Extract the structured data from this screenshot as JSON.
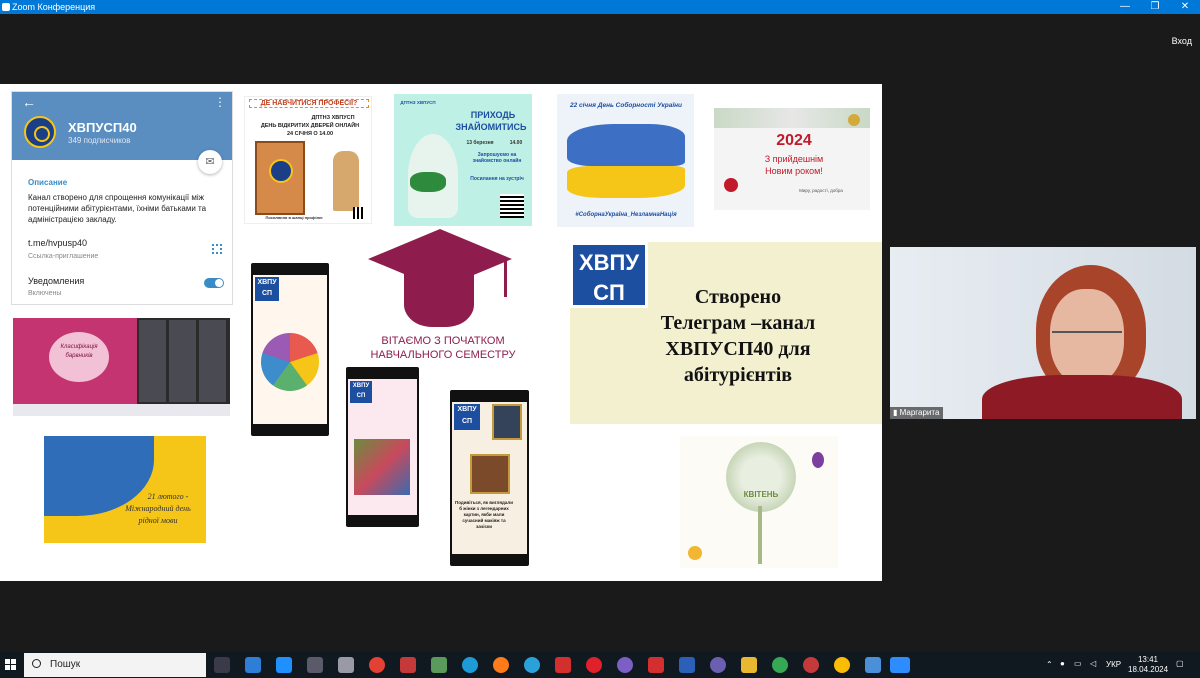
{
  "window": {
    "title": "Zoom Конференция",
    "minimize": "—",
    "maximize": "❐",
    "close": "✕",
    "signin": "Вход"
  },
  "telegram": {
    "back": "←",
    "menu": "⋮",
    "channel_name": "ХВПУСП40",
    "subscribers": "349 подписчиков",
    "desc_label": "Описание",
    "description": "Канал створено для спрощення комунікації між потенційними абітурієнтами, їхніми батьками та адміністрацією закладу.",
    "link": "t.me/hvpusp40",
    "link_sub": "Ссылка-приглашение",
    "notif_label": "Уведомления",
    "notif_state": "Включены"
  },
  "slides": {
    "profession": {
      "title": "ДЕ НАВЧИТИСЯ ПРОФЕСІЇ?",
      "line1": "ДПТНЗ ХВПУСП",
      "line2": "ДЕНЬ ВІДКРИТИХ ДВЕРЕЙ ОНЛАЙН",
      "line3": "24 СІЧНЯ О 14.00",
      "footer": "Посилання в шапці профілю"
    },
    "meet": {
      "top": "ДПТНЗ ХВПУСП",
      "title1": "ПРИХОДЬ",
      "title2": "ЗНАЙОМИТИСЬ",
      "date": "13 березня",
      "time": "14.00",
      "invite": "Запрошуємо на знайомство онлайн",
      "link": "Посилання на зустріч"
    },
    "unity": {
      "title": "22 січня День Соборності України",
      "tags": "#СоборнаУкраїна_НезламнаНація"
    },
    "newyear": {
      "year": "2024",
      "text1": "З прийдешнім",
      "text2": "Новим роком!",
      "small": "Миру, радості, добра"
    },
    "cap": {
      "line1": "ВІТАЄМО З ПОЧАТКОМ",
      "line2": "НАВЧАЛЬНОГО СЕМЕСТРУ"
    },
    "logo": {
      "top": "ХВПУ",
      "bottom": "СП"
    },
    "telegram_created": {
      "line1": "Створено",
      "line2": "Телеграм –канал",
      "line3": "ХВПУСП40 для",
      "line4": "абітурієнтів"
    },
    "classification": {
      "title1": "Класифікація",
      "title2": "барвників"
    },
    "mother_language": {
      "line1": "21 лютого -",
      "line2": "Міжнародний день",
      "line3": "рідної мови"
    },
    "april": {
      "word": "КВІТЕНЬ"
    },
    "phone3": {
      "caption": "Подивіться, як виглядали б жінки з легендарних картин, якби мали сучасний макіяж та зачіски"
    }
  },
  "webcam": {
    "name": "Маргарита"
  },
  "taskbar": {
    "search_placeholder": "Пошук",
    "lang": "УКР",
    "time": "13:41",
    "date": "18.04.2024"
  },
  "colors": {
    "titlebar": "#0078d7",
    "telegram_header": "#5a8dc0",
    "cap_maroon": "#8e1d4e",
    "logo_blue": "#1d4fa0",
    "panel_yellow": "#f2f0cf"
  }
}
